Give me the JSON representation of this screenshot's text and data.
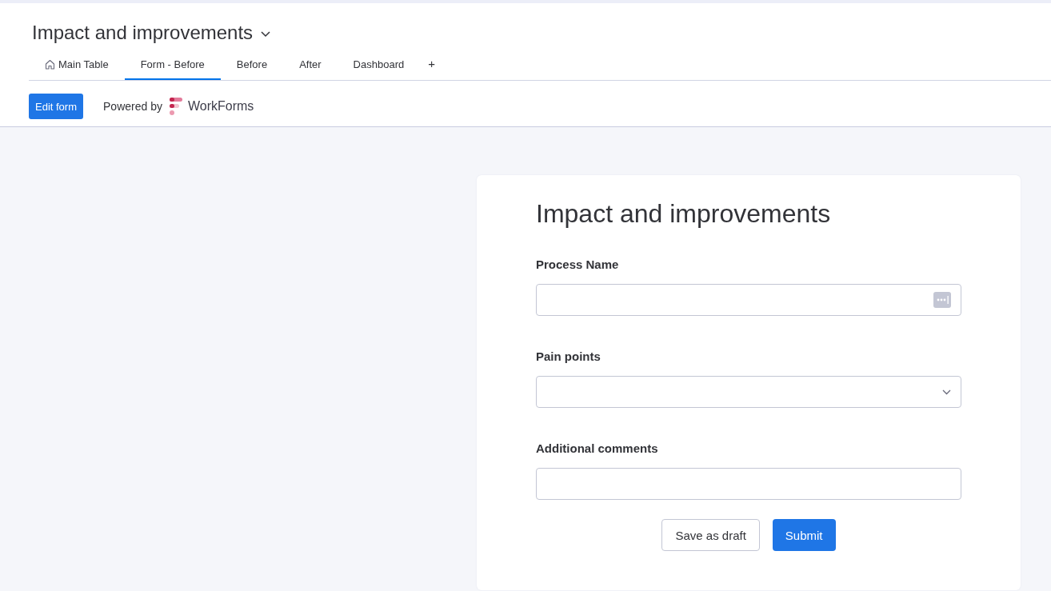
{
  "board": {
    "title": "Impact and improvements"
  },
  "tabs": [
    {
      "label": "Main Table",
      "kind": "home",
      "selected": false
    },
    {
      "label": "Form - Before",
      "kind": "view",
      "selected": true
    },
    {
      "label": "Before",
      "kind": "view",
      "selected": false
    },
    {
      "label": "After",
      "kind": "view",
      "selected": false
    },
    {
      "label": "Dashboard",
      "kind": "view",
      "selected": false
    }
  ],
  "add_tab": "+",
  "toolbar": {
    "edit_button": "Edit form",
    "powered_by": "Powered by",
    "brand": "WorkForms"
  },
  "form": {
    "title": "Impact and improvements",
    "fields": [
      {
        "label": "Process Name",
        "kind": "text"
      },
      {
        "label": "Pain points",
        "kind": "dropdown"
      },
      {
        "label": "Additional comments",
        "kind": "textarea"
      }
    ],
    "buttons": [
      {
        "label": "Save as draft",
        "kind": "secondary"
      },
      {
        "label": "Submit",
        "kind": "primary"
      }
    ]
  }
}
